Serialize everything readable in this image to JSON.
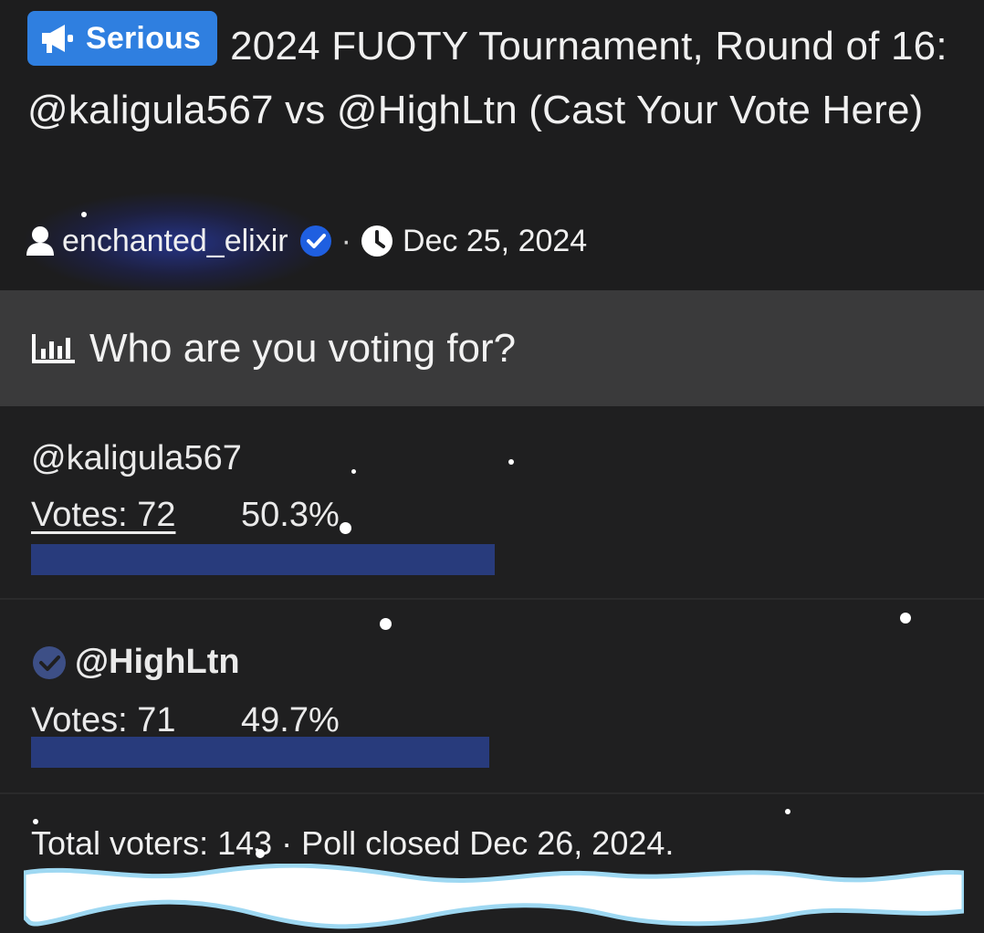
{
  "thread": {
    "prefix_label": "Serious",
    "title": "2024 FUOTY Tournament, Round of 16: @kaligula567 vs @HighLtn (Cast Your Vote Here)",
    "author": "enchanted_elixir",
    "separator": "·",
    "date": "Dec 25, 2024"
  },
  "poll": {
    "question": "Who are you voting for?",
    "options": [
      {
        "name": "@kaligula567",
        "votes_text": "Votes: 72",
        "percent_text": "50.3%",
        "percent": 50.3
      },
      {
        "name": "@HighLtn",
        "votes_text": "Votes: 71",
        "percent_text": "49.7%",
        "percent": 49.7
      }
    ],
    "footer": "Total voters: 143 · Poll closed Dec 26, 2024."
  },
  "colors": {
    "prefix_bg": "#2f7fe0",
    "bar_fill": "#283b7c",
    "poll_header_bg": "#3a3a3b",
    "verified_badge": "#1f5fe0"
  },
  "icons": {
    "prefix": "megaphone-icon",
    "author": "user-icon",
    "verified": "verified-check-icon",
    "date": "clock-icon",
    "poll": "bar-chart-icon"
  }
}
